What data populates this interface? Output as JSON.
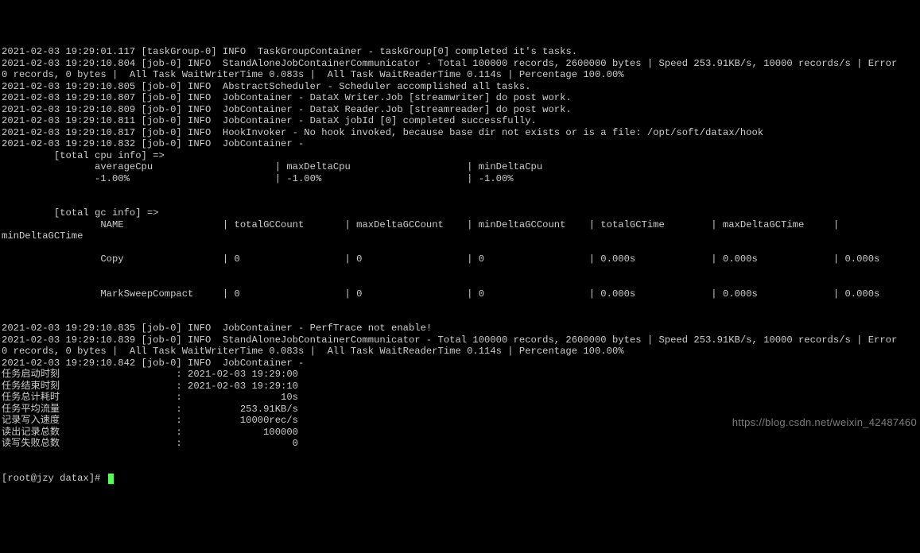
{
  "lines": [
    "2021-02-03 19:29:01.117 [taskGroup-0] INFO  TaskGroupContainer - taskGroup[0] completed it's tasks.",
    "2021-02-03 19:29:10.804 [job-0] INFO  StandAloneJobContainerCommunicator - Total 100000 records, 2600000 bytes | Speed 253.91KB/s, 10000 records/s | Error 0 records, 0 bytes |  All Task WaitWriterTime 0.083s |  All Task WaitReaderTime 0.114s | Percentage 100.00%",
    "2021-02-03 19:29:10.805 [job-0] INFO  AbstractScheduler - Scheduler accomplished all tasks.",
    "2021-02-03 19:29:10.807 [job-0] INFO  JobContainer - DataX Writer.Job [streamwriter] do post work.",
    "2021-02-03 19:29:10.809 [job-0] INFO  JobContainer - DataX Reader.Job [streamreader] do post work.",
    "2021-02-03 19:29:10.811 [job-0] INFO  JobContainer - DataX jobId [0] completed successfully.",
    "2021-02-03 19:29:10.817 [job-0] INFO  HookInvoker - No hook invoked, because base dir not exists or is a file: /opt/soft/datax/hook",
    "2021-02-03 19:29:10.832 [job-0] INFO  JobContainer - ",
    "         [total cpu info] => ",
    "                averageCpu                     | maxDeltaCpu                    | minDeltaCpu                    ",
    "                -1.00%                         | -1.00%                         | -1.00%",
    "                        ",
    "",
    "         [total gc info] => ",
    "                 NAME                 | totalGCCount       | maxDeltaGCCount    | minDeltaGCCount    | totalGCTime        | maxDeltaGCTime     | minDeltaGCTime     ",
    "",
    "                 Copy                 | 0                  | 0                  | 0                  | 0.000s             | 0.000s             | 0.000s             ",
    "",
    "                 MarkSweepCompact     | 0                  | 0                  | 0                  | 0.000s             | 0.000s             | 0.000s             ",
    "",
    "2021-02-03 19:29:10.835 [job-0] INFO  JobContainer - PerfTrace not enable!",
    "2021-02-03 19:29:10.839 [job-0] INFO  StandAloneJobContainerCommunicator - Total 100000 records, 2600000 bytes | Speed 253.91KB/s, 10000 records/s | Error 0 records, 0 bytes |  All Task WaitWriterTime 0.083s |  All Task WaitReaderTime 0.114s | Percentage 100.00%",
    "2021-02-03 19:29:10.842 [job-0] INFO  JobContainer - ",
    "任务启动时刻                    : 2021-02-03 19:29:00",
    "任务结束时刻                    : 2021-02-03 19:29:10",
    "任务总计耗时                    :                 10s",
    "任务平均流量                    :          253.91KB/s",
    "记录写入速度                    :          10000rec/s",
    "读出记录总数                    :              100000",
    "读写失败总数                    :                   0",
    ""
  ],
  "prompt": "[root@jzy datax]# ",
  "watermark": "https://blog.csdn.net/weixin_42487460"
}
